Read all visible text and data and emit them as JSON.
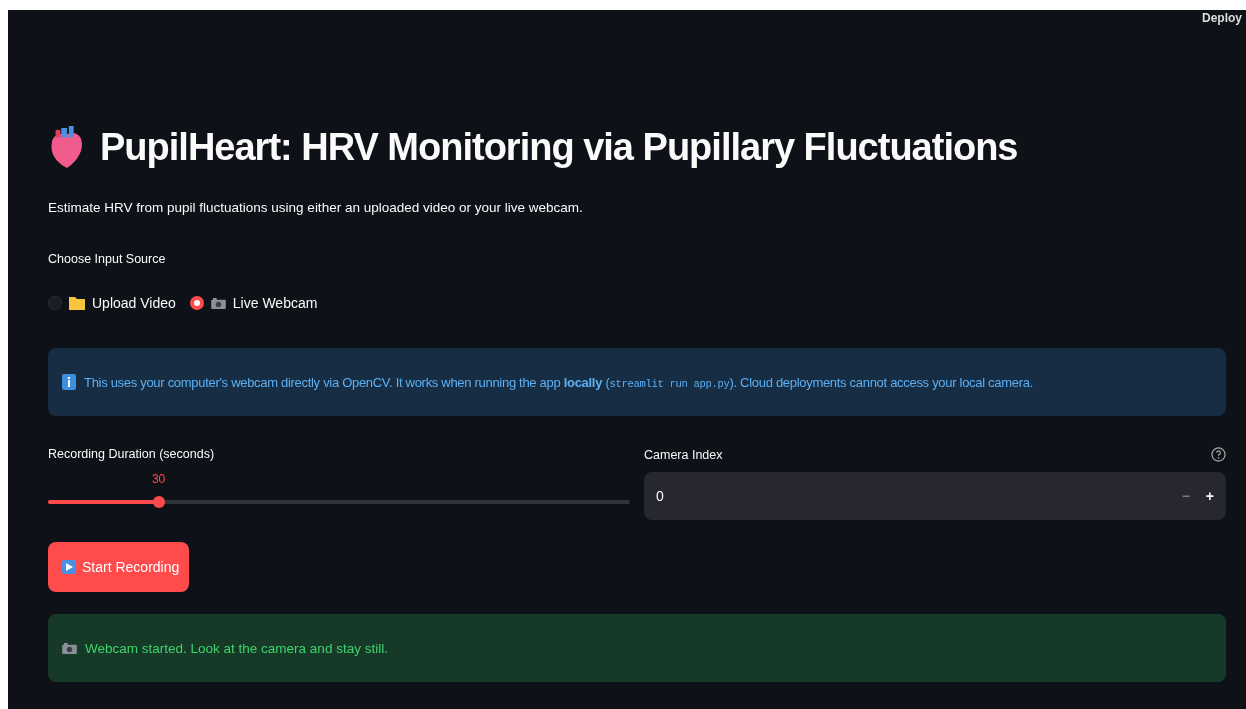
{
  "header": {
    "deploy": "Deploy"
  },
  "title": "PupilHeart: HRV Monitoring via Pupillary Fluctuations",
  "subtitle": "Estimate HRV from pupil fluctuations using either an uploaded video or your live webcam.",
  "input_source": {
    "label": "Choose Input Source",
    "options": [
      {
        "label": "Upload Video",
        "kind": "folder",
        "selected": false
      },
      {
        "label": "Live Webcam",
        "kind": "camera",
        "selected": true
      }
    ]
  },
  "info": {
    "text": "This uses your computer's webcam directly via OpenCV. It works when running the app **locally** (",
    "code": "streamlit run app.py",
    "text_after": "). Cloud deployments cannot access your local camera."
  },
  "slider": {
    "label": "Recording Duration (seconds)",
    "reading": "30",
    "level": 0.19
  },
  "camera_index": {
    "label": "Camera Index",
    "value": "0",
    "minus": "−",
    "plus": "+"
  },
  "start_button": {
    "label": "Start Recording"
  },
  "status": {
    "text": "Webcam started. Look at the camera and stay still."
  }
}
